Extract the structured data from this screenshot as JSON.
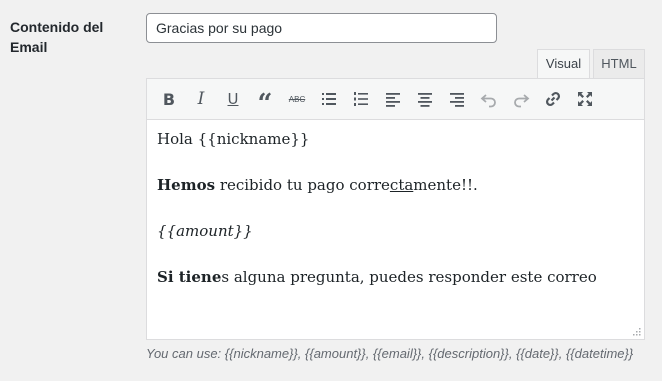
{
  "field": {
    "label": "Contenido del Email",
    "subject_value": "Gracias por su pago"
  },
  "editor": {
    "tabs": [
      {
        "label": "Visual",
        "active": true
      },
      {
        "label": "HTML",
        "active": false
      }
    ],
    "toolbar": [
      {
        "name": "bold-icon",
        "glyph": "B"
      },
      {
        "name": "italic-icon",
        "glyph": "I"
      },
      {
        "name": "underline-icon",
        "glyph": "U"
      },
      {
        "name": "blockquote-icon",
        "glyph": "“"
      },
      {
        "name": "strikethrough-icon",
        "glyph": "ABC"
      },
      {
        "name": "bullet-list-icon"
      },
      {
        "name": "numbered-list-icon"
      },
      {
        "name": "align-left-icon"
      },
      {
        "name": "align-center-icon"
      },
      {
        "name": "align-right-icon"
      },
      {
        "name": "undo-icon"
      },
      {
        "name": "redo-icon"
      },
      {
        "name": "link-icon"
      },
      {
        "name": "fullscreen-icon"
      }
    ],
    "content": {
      "line1": "Hola {{nickname}}",
      "line2_bold": "Hemos",
      "line2_a": " recibido tu pago corre",
      "line2_underline": "cta",
      "line2_b": "mente!!.",
      "line3_italic": "{{amount}}",
      "line4_bold": "Si tiene",
      "line4_rest": "s alguna pregunta, puedes responder este correo"
    }
  },
  "help_text": "You can use: {{nickname}}, {{amount}}, {{email}}, {{description}}, {{date}}, {{datetime}}"
}
